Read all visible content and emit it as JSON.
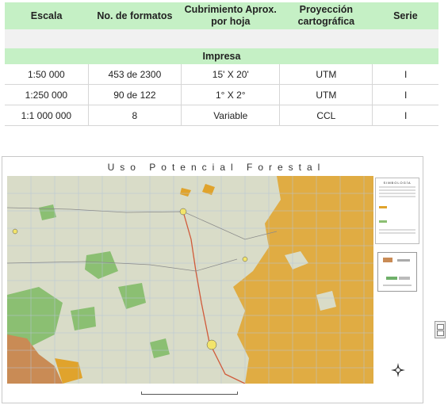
{
  "table": {
    "headers": [
      "Escala",
      "No. de formatos",
      "Cubrimiento Aprox.\npor hoja",
      "Proyección\ncartográfica",
      "Serie"
    ],
    "section_label": "Impresa",
    "rows": [
      [
        "1:50 000",
        "453 de 2300",
        "15' X 20'",
        "UTM",
        "I"
      ],
      [
        "1:250 000",
        "90 de 122",
        "1° X 2°",
        "UTM",
        "I"
      ],
      [
        "1:1 000 000",
        "8",
        "Variable",
        "CCL",
        "I"
      ]
    ]
  },
  "map": {
    "title": "Uso Potencial Forestal",
    "legend_title": "SIMBOLOGÍA",
    "colors": {
      "base": "#d9dcc8",
      "forest_orange": "#e0a32c",
      "forest_green": "#8bbf72",
      "grid": "#b5c4d8",
      "road": "#d05a3a"
    }
  }
}
